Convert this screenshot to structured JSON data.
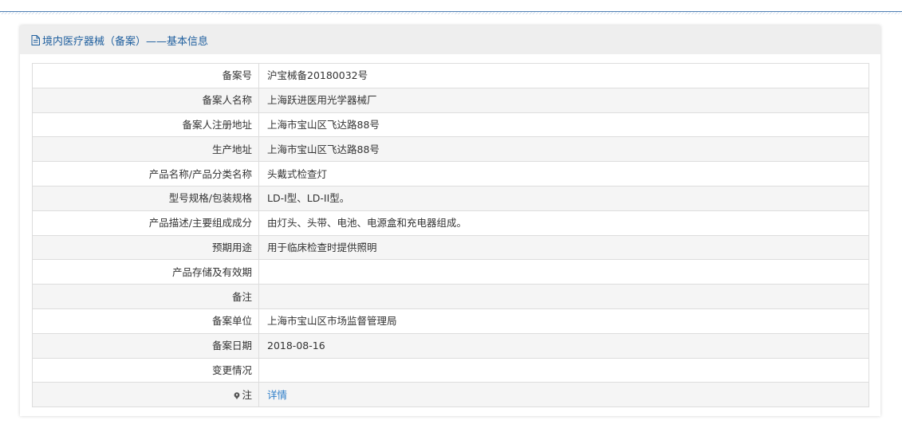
{
  "header": {
    "title": "境内医疗器械（备案）——基本信息",
    "icon": "document-icon"
  },
  "rows": [
    {
      "label": "备案号",
      "value": "沪宝械备20180032号"
    },
    {
      "label": "备案人名称",
      "value": "上海跃进医用光学器械厂"
    },
    {
      "label": "备案人注册地址",
      "value": "上海市宝山区飞达路88号"
    },
    {
      "label": "生产地址",
      "value": "上海市宝山区飞达路88号"
    },
    {
      "label": "产品名称/产品分类名称",
      "value": "头戴式检查灯"
    },
    {
      "label": "型号规格/包装规格",
      "value": "LD-I型、LD-II型。"
    },
    {
      "label": "产品描述/主要组成成分",
      "value": "由灯头、头带、电池、电源盒和充电器组成。"
    },
    {
      "label": "预期用途",
      "value": "用于临床检查时提供照明"
    },
    {
      "label": "产品存储及有效期",
      "value": ""
    },
    {
      "label": "备注",
      "value": ""
    },
    {
      "label": "备案单位",
      "value": "上海市宝山区市场监督管理局"
    },
    {
      "label": "备案日期",
      "value": "2018-08-16"
    },
    {
      "label": "变更情况",
      "value": ""
    }
  ],
  "note_row": {
    "label": "注",
    "icon": "pin-icon",
    "link_text": "详情"
  },
  "colors": {
    "header_text": "#1f5f9e",
    "link": "#2f7fc9",
    "border": "#dddddd",
    "header_bg": "#eeeeee"
  }
}
